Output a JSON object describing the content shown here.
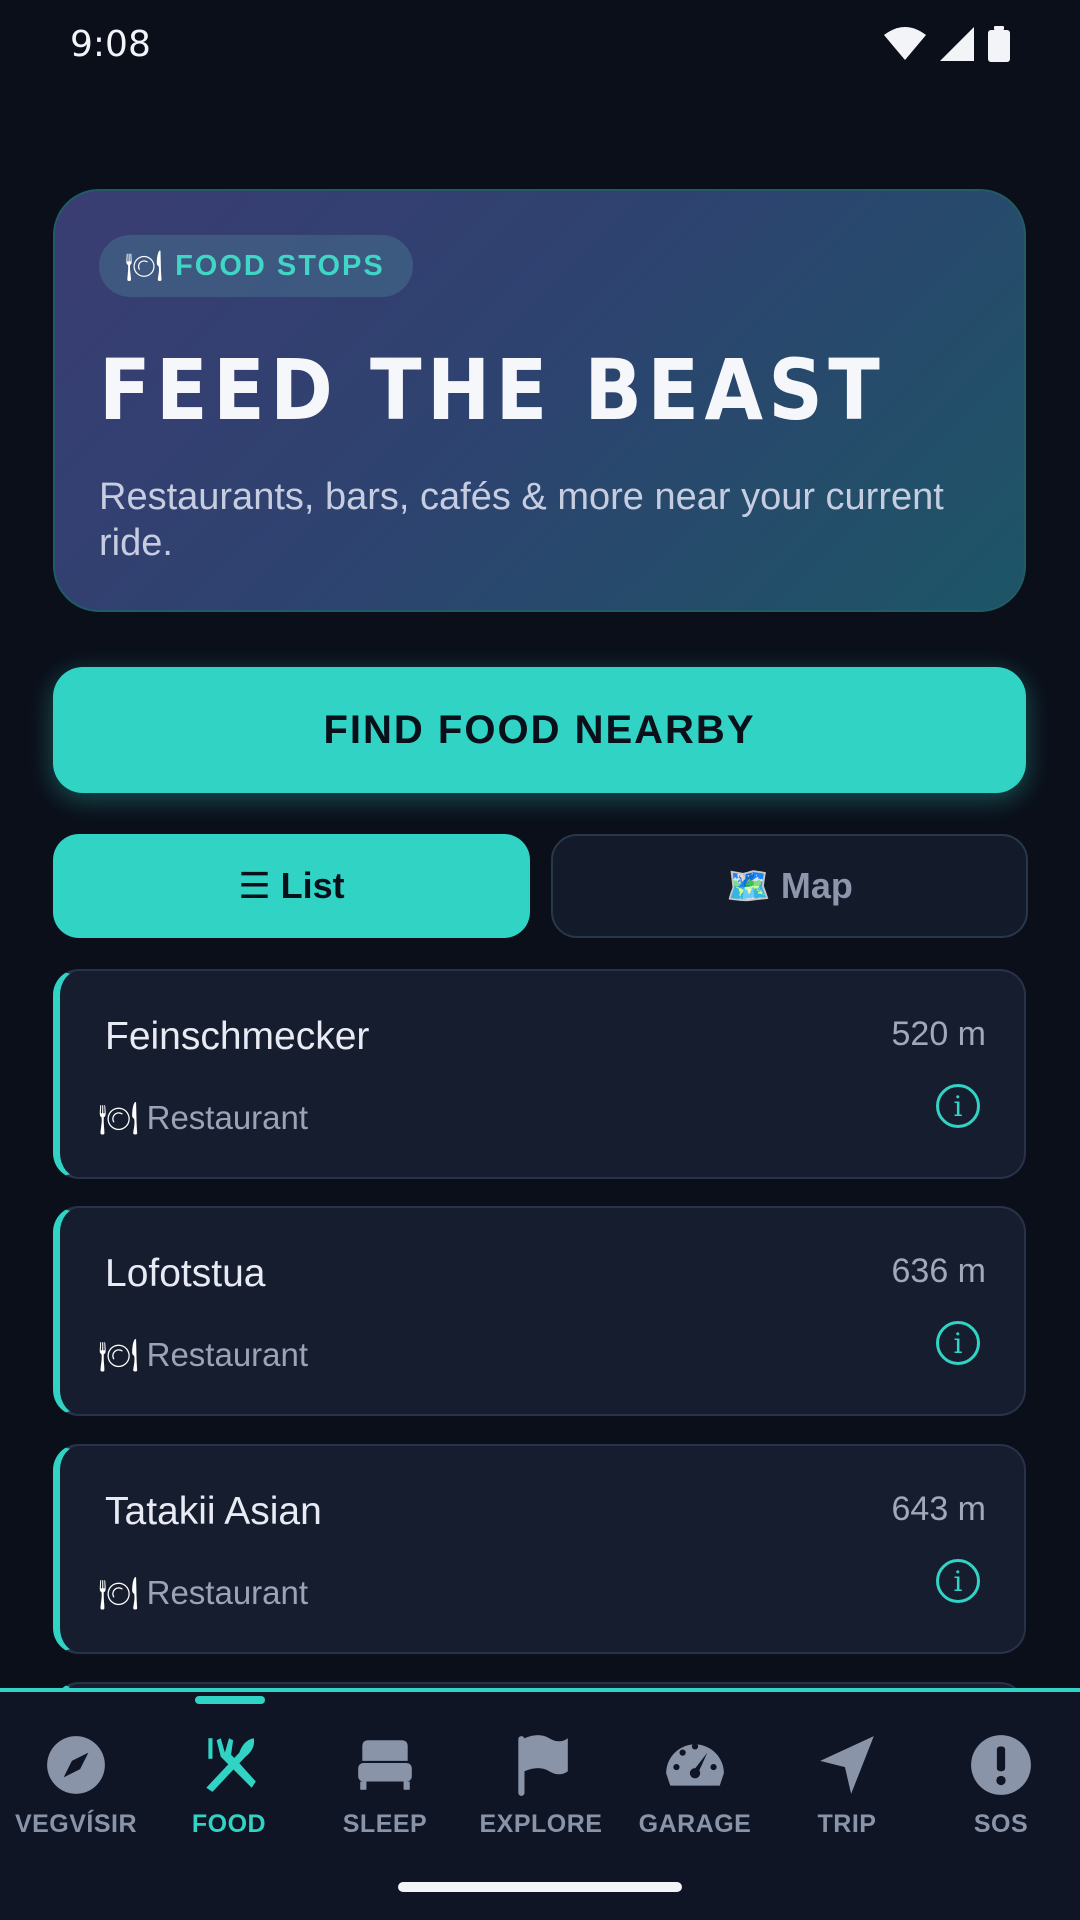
{
  "status_bar": {
    "time": "9:08"
  },
  "hero": {
    "badge_icon": "fork-knife-plate-icon",
    "badge_glyph": "🍽",
    "badge_label": "FOOD STOPS",
    "title": "FEED THE BEAST",
    "subtitle": "Restaurants, bars, cafés & more near your current ride."
  },
  "actions": {
    "find_label": "FIND FOOD NEARBY"
  },
  "view_toggle": {
    "list_label": "☰ List",
    "map_label": "🗺️ Map",
    "selected": "List"
  },
  "places": [
    {
      "name": "Feinschmecker",
      "type": "Restaurant",
      "distance": "520 m"
    },
    {
      "name": "Lofotstua",
      "type": "Restaurant",
      "distance": "636 m"
    },
    {
      "name": "Tatakii Asian",
      "type": "Restaurant",
      "distance": "643 m"
    }
  ],
  "place_type_glyph": "🍽",
  "info_glyph": "i",
  "nav": {
    "active": "FOOD",
    "items": [
      {
        "label": "VEGVÍSIR",
        "icon": "compass-icon"
      },
      {
        "label": "FOOD",
        "icon": "fork-knife-icon"
      },
      {
        "label": "SLEEP",
        "icon": "bed-icon"
      },
      {
        "label": "EXPLORE",
        "icon": "flag-icon"
      },
      {
        "label": "GARAGE",
        "icon": "speedometer-icon"
      },
      {
        "label": "TRIP",
        "icon": "navigation-arrow-icon"
      },
      {
        "label": "SOS",
        "icon": "alert-icon"
      }
    ]
  },
  "colors": {
    "background": "#0b0f1a",
    "accent": "#30d3c4",
    "card": "#161d2e",
    "muted": "#8a94a9"
  }
}
